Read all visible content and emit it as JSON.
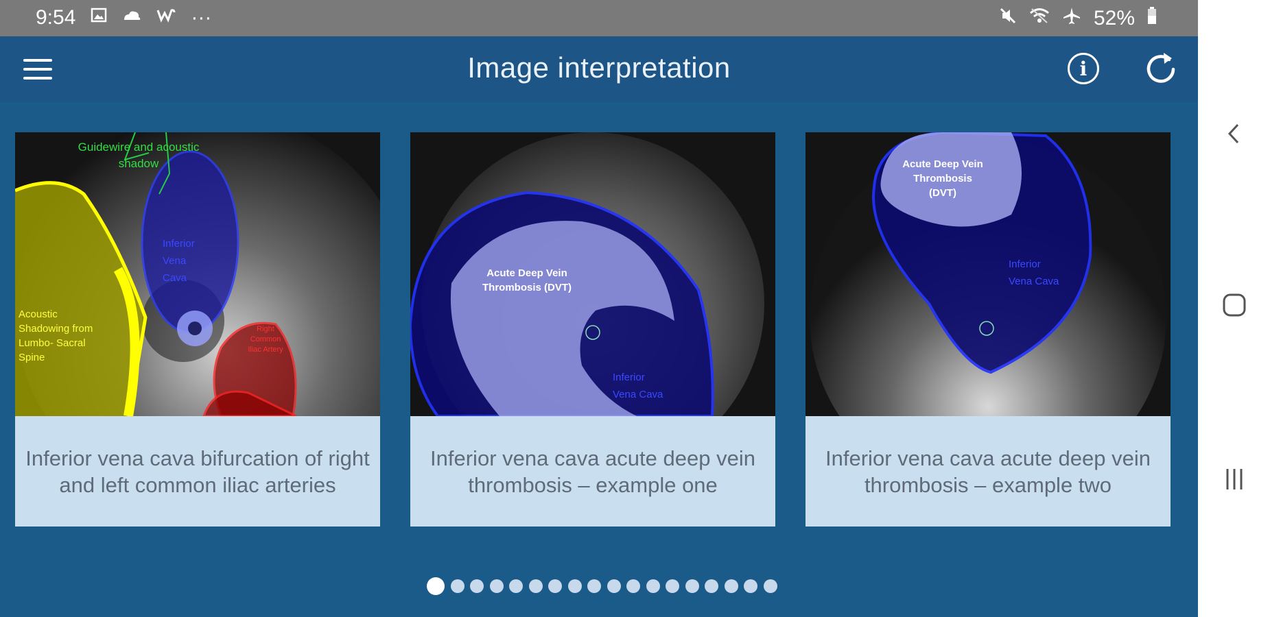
{
  "status_bar": {
    "time": "9:54",
    "dots": "···",
    "battery": "52%",
    "icons_left": [
      "image-icon",
      "cloud-icon",
      "w-icon"
    ],
    "icons_right": [
      "mute-icon",
      "wifi-icon",
      "airplane-icon",
      "battery-icon"
    ]
  },
  "app_bar": {
    "title": "Image interpretation",
    "icons": [
      "menu-icon",
      "info-icon",
      "refresh-icon"
    ],
    "info_glyph": "i"
  },
  "cards": [
    {
      "caption": "Inferior vena cava bifurcation of right and left common iliac arteries",
      "labels": {
        "guidewire": "Guidewire  and acoustic shadow",
        "ivc": "Inferior Vena Cava",
        "shadow": "Acoustic Shadowing from Lumbo- Sacral Spine",
        "artery": "Right Common Iliac Artery"
      }
    },
    {
      "caption": "Inferior vena cava acute deep vein thrombosis – example one",
      "labels": {
        "dvt": "Acute Deep Vein Thrombosis (DVT)",
        "ivc": "Inferior Vena Cava"
      }
    },
    {
      "caption": "Inferior vena cava acute deep vein thrombosis – example two",
      "labels": {
        "dvt": "Acute Deep Vein Thrombosis (DVT)",
        "ivc": "Inferior Vena Cava"
      }
    }
  ],
  "pagination": {
    "total": 18,
    "active_index": 0
  },
  "colors": {
    "app_bar": "#1d5586",
    "background": "#1b5b8a",
    "caption_bg": "#c9dff0",
    "caption_text": "#5f6b78",
    "status_bar": "#7a7a7a"
  },
  "system_nav": [
    "back-icon",
    "home-icon",
    "recents-icon"
  ]
}
